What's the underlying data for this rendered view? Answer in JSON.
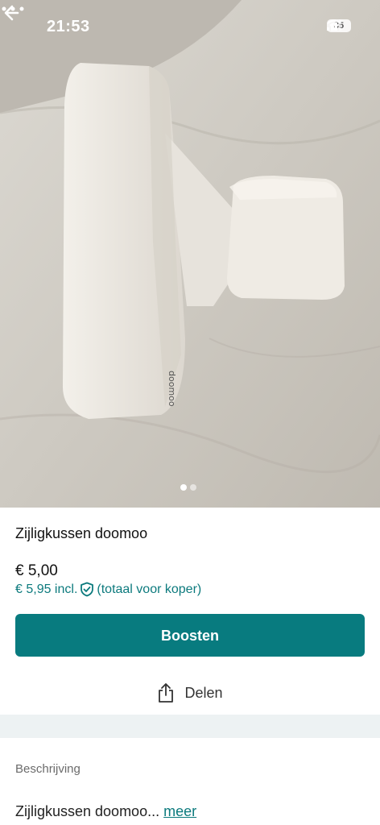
{
  "status": {
    "time": "21:53",
    "battery": "35",
    "icons": [
      "signal-icon",
      "wifi-icon",
      "battery-icon"
    ]
  },
  "photo": {
    "brand_print": "doomoo",
    "page_count": 2,
    "active_page": 1
  },
  "product": {
    "title": "Zijligkussen doomoo",
    "price": "€ 5,00",
    "price_incl": "€ 5,95 incl.",
    "price_incl_note": "(totaal voor koper)"
  },
  "actions": {
    "boost_label": "Boosten",
    "share_label": "Delen"
  },
  "description": {
    "heading": "Beschrijving",
    "text": "Zijligkussen doomoo...",
    "more_label": "meer"
  },
  "colors": {
    "accent": "#087b7f",
    "accent_text": "#0c7a7d",
    "band": "#edf2f3"
  }
}
